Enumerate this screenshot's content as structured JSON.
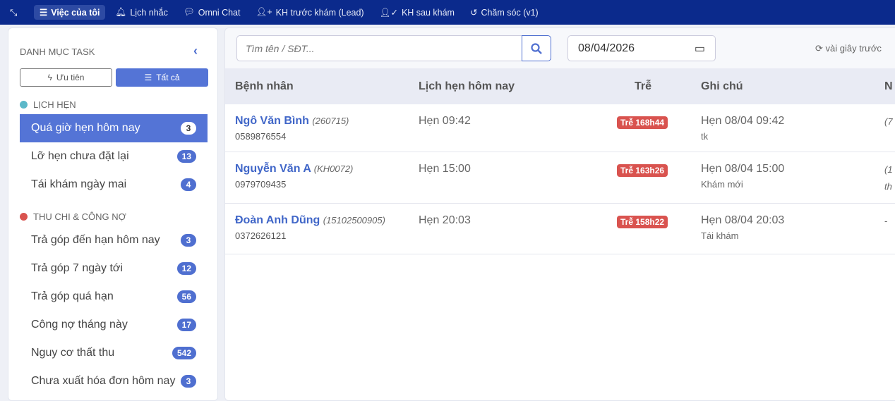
{
  "topnav": {
    "items": [
      {
        "label": "Việc của tôi",
        "icon": "list-check-icon",
        "glyph": "☰"
      },
      {
        "label": "Lịch nhắc",
        "icon": "bell-icon",
        "glyph": "🔔"
      },
      {
        "label": "Omni Chat",
        "icon": "chat-icon",
        "glyph": "💬"
      },
      {
        "label": "KH trước khám (Lead)",
        "icon": "user-plus-icon",
        "glyph": "👤"
      },
      {
        "label": "KH sau khám",
        "icon": "user-check-icon",
        "glyph": "👤"
      },
      {
        "label": "Chăm sóc (v1)",
        "icon": "history-icon",
        "glyph": "↺"
      }
    ]
  },
  "sidebar": {
    "title": "DANH MỤC TASK",
    "priority_label": "Ưu tiên",
    "all_label": "Tất cả",
    "groups": [
      {
        "label": "LỊCH HẸN",
        "color": "#5bb8c9"
      },
      {
        "label": "THU CHI & CÔNG NỢ",
        "color": "#d9534f"
      }
    ],
    "items": [
      {
        "label": "Quá giờ hẹn hôm nay",
        "count": "3"
      },
      {
        "label": "Lỡ hẹn chưa đặt lại",
        "count": "13"
      },
      {
        "label": "Tái khám ngày mai",
        "count": "4"
      },
      {
        "label": "Trả góp đến hạn hôm nay",
        "count": "3"
      },
      {
        "label": "Trả góp 7 ngày tới",
        "count": "12"
      },
      {
        "label": "Trả góp quá hạn",
        "count": "56"
      },
      {
        "label": "Công nợ tháng này",
        "count": "17"
      },
      {
        "label": "Nguy cơ thất thu",
        "count": "542"
      },
      {
        "label": "Chưa xuất hóa đơn hôm nay",
        "count": "3"
      }
    ]
  },
  "main": {
    "search_placeholder": "Tìm tên / SĐT...",
    "date": "08/04/2026",
    "refresh": "vài giây trước",
    "columns": [
      "Bệnh nhân",
      "Lịch hẹn hôm nay",
      "Trễ",
      "Ghi chú",
      "N"
    ],
    "rows": [
      {
        "name": "Ngô Văn Bình",
        "code": "(260715)",
        "phone": "0589876554",
        "appt": "Hẹn 09:42",
        "late": "Trễ 168h44",
        "note": "Hẹn 08/04 09:42",
        "note_sub": "tk",
        "extra": "(7",
        "extra2": ""
      },
      {
        "name": "Nguyễn Văn A",
        "code": "(KH0072)",
        "phone": "0979709435",
        "appt": "Hẹn 15:00",
        "late": "Trễ 163h26",
        "note": "Hẹn 08/04 15:00",
        "note_sub": "Khám mới",
        "extra": "(1",
        "extra2": "th"
      },
      {
        "name": "Đoàn Anh Dũng",
        "code": "(15102500905)",
        "phone": "0372626121",
        "appt": "Hẹn 20:03",
        "late": "Trễ 158h22",
        "note": "Hẹn 08/04 20:03",
        "note_sub": "Tái khám",
        "extra": "-",
        "extra2": ""
      }
    ]
  }
}
